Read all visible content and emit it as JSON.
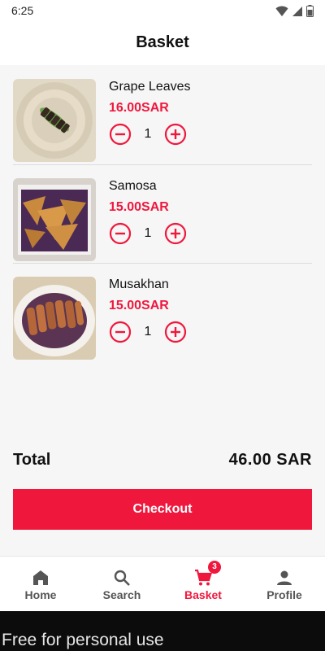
{
  "status_bar": {
    "time": "6:25"
  },
  "header": {
    "title": "Basket"
  },
  "items": [
    {
      "name": "Grape Leaves",
      "price": "16.00SAR",
      "quantity": "1"
    },
    {
      "name": "Samosa",
      "price": "15.00SAR",
      "quantity": "1"
    },
    {
      "name": "Musakhan",
      "price": "15.00SAR",
      "quantity": "1"
    }
  ],
  "total": {
    "label": "Total",
    "value": "46.00 SAR"
  },
  "checkout_label": "Checkout",
  "nav": {
    "items": [
      {
        "label": "Home",
        "icon": "home-icon"
      },
      {
        "label": "Search",
        "icon": "search-icon"
      },
      {
        "label": "Basket",
        "icon": "cart-icon",
        "badge": "3"
      },
      {
        "label": "Profile",
        "icon": "person-icon"
      }
    ],
    "active": "Basket"
  },
  "watermark": "Free for personal use",
  "colors": {
    "accent": "#f0173d",
    "nav_inactive": "#555555",
    "background": "#f6f6f6"
  }
}
